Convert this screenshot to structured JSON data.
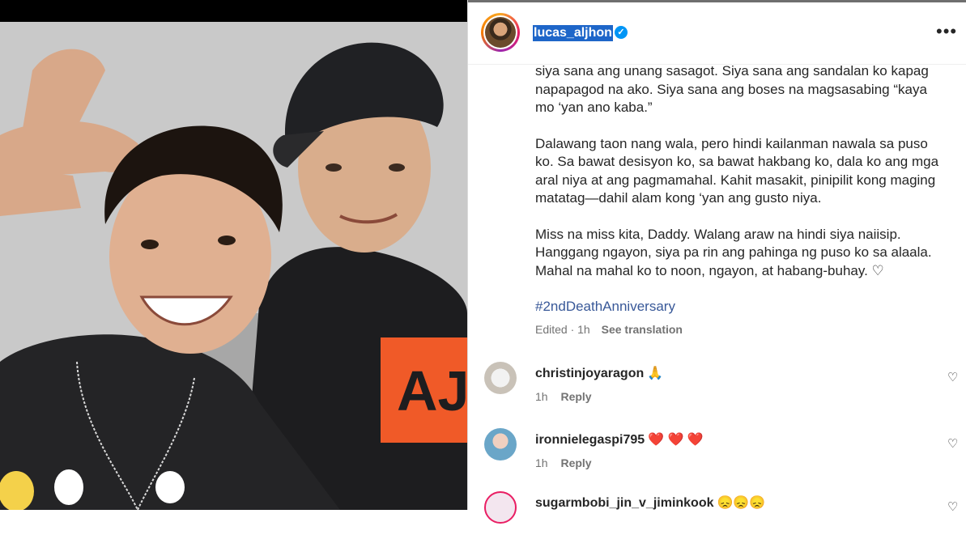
{
  "post": {
    "username": "lucas_aljhon",
    "caption": [
      "siya sana ang unang sasagot. Siya sana ang sandalan ko kapag napapagod na ako. Siya sana ang boses na magsasabing “kaya mo ‘yan ano kaba.”",
      "Dalawang taon nang wala, pero hindi kailanman nawala sa puso ko. Sa bawat desisyon ko, sa bawat hakbang ko, dala ko ang mga aral niya at ang pagmamahal. Kahit masakit, pinipilit kong maging matatag—dahil alam kong ‘yan ang gusto niya.",
      "Miss na miss kita, Daddy. Walang araw na hindi siya naiisip. Hanggang ngayon, siya pa rin ang pahinga ng puso ko sa alaala. Mahal na mahal ko to noon, ngayon, at habang-buhay. ♡"
    ],
    "hashtag": "#2ndDeathAnniversary",
    "edited": "Edited · 1h",
    "see_translation": "See translation"
  },
  "comments": [
    {
      "username": "christinjoyaragon",
      "emoji": "🙏",
      "time": "1h",
      "reply": "Reply"
    },
    {
      "username": "ironnielegaspi795",
      "emoji": "❤️ ❤️ ❤️",
      "time": "1h",
      "reply": "Reply"
    },
    {
      "username": "sugarmbobi_jin_v_jiminkook",
      "emoji": "😞😞😞",
      "time": "",
      "reply": ""
    }
  ],
  "icons": {
    "verified": "verified-badge-icon",
    "more": "more-options-icon",
    "like": "heart-icon"
  },
  "colors": {
    "username_highlight": "#1e66c9",
    "hashtag": "#385898",
    "verified": "#0095f6",
    "shirt_print": "#f05a28"
  }
}
